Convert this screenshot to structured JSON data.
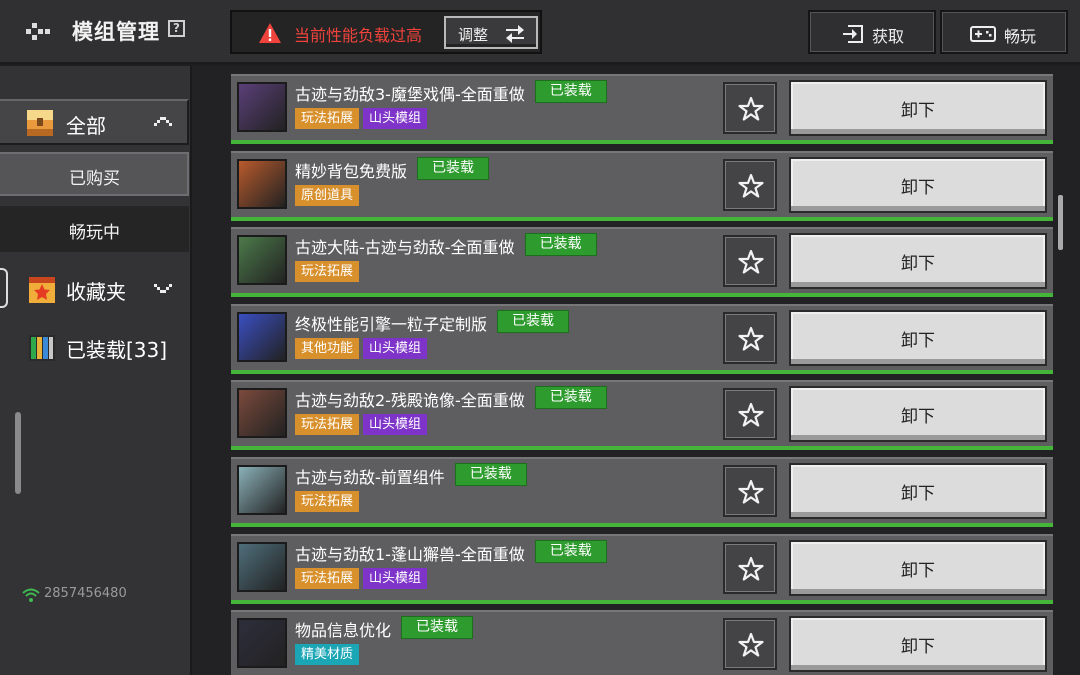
{
  "header": {
    "title": "模组管理",
    "help": "?",
    "warning": "当前性能负载过高",
    "adjust_label": "调整",
    "get_label": "获取",
    "play_label": "畅玩"
  },
  "sidebar": {
    "all_label": "全部",
    "bought_label": "已购买",
    "playing_label": "畅玩中",
    "favorites_label": "收藏夹",
    "loaded_label": "已装载[33]",
    "user_id": "2857456480"
  },
  "mods": [
    {
      "name": "古迹与劲敌3-魔堡戏偶-全面重做",
      "status": "已装载",
      "tags": [
        "玩法拓展",
        "山头模组"
      ],
      "unload": "卸下",
      "thumb_color": "#5a3f78"
    },
    {
      "name": "精妙背包免费版",
      "status": "已装载",
      "tags": [
        "原创道具"
      ],
      "unload": "卸下",
      "thumb_color": "#b85a2c"
    },
    {
      "name": "古迹大陆-古迹与劲敌-全面重做",
      "status": "已装载",
      "tags": [
        "玩法拓展"
      ],
      "unload": "卸下",
      "thumb_color": "#4c7a4a"
    },
    {
      "name": "终极性能引擎一粒子定制版",
      "status": "已装载",
      "tags": [
        "其他功能",
        "山头模组"
      ],
      "unload": "卸下",
      "thumb_color": "#3a4ec0"
    },
    {
      "name": "古迹与劲敌2-残殿诡像-全面重做",
      "status": "已装载",
      "tags": [
        "玩法拓展",
        "山头模组"
      ],
      "unload": "卸下",
      "thumb_color": "#7a4a3c"
    },
    {
      "name": "古迹与劲敌-前置组件",
      "status": "已装载",
      "tags": [
        "玩法拓展"
      ],
      "unload": "卸下",
      "thumb_color": "#8ab0b8"
    },
    {
      "name": "古迹与劲敌1-蓬山獬兽-全面重做",
      "status": "已装载",
      "tags": [
        "玩法拓展",
        "山头模组"
      ],
      "unload": "卸下",
      "thumb_color": "#4e6e7a"
    },
    {
      "name": "物品信息优化",
      "status": "已装载",
      "tags": [
        "精美材质"
      ],
      "unload": "卸下",
      "thumb_color": "#2e2e3c"
    }
  ],
  "colors": {
    "accent_green": "#45b53a",
    "warning_red": "#f0433c",
    "tag_orange": "#d8902c",
    "tag_purple": "#7e34c8",
    "tag_teal": "#1ba6b6"
  },
  "icons": [
    "back-icon",
    "help-icon",
    "warning-icon",
    "swap-icon",
    "import-icon",
    "gamepad-icon",
    "chest-icon",
    "chevron-up-icon",
    "star-box-icon",
    "bookshelf-icon",
    "chevron-down-icon",
    "wifi-icon",
    "star-icon"
  ]
}
